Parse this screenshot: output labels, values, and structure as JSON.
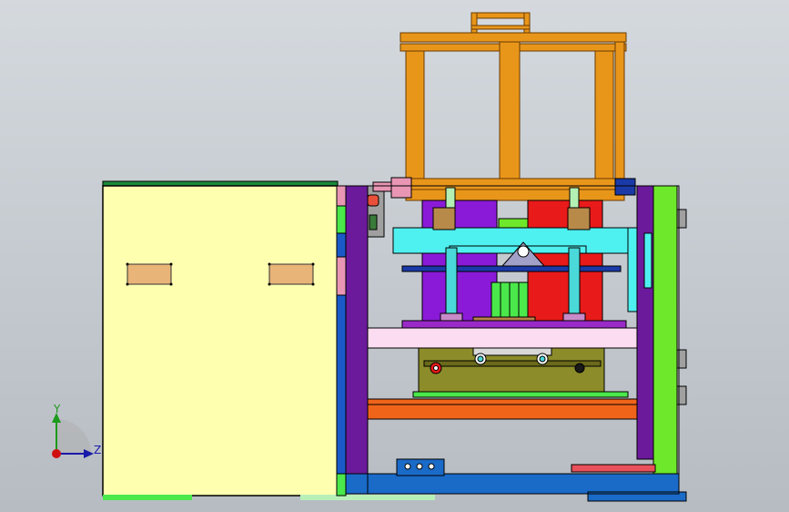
{
  "viewport": {
    "background_top": "#d4d9de",
    "background_bottom": "#b6bcc2"
  },
  "triad": {
    "y_label": "Y",
    "z_label": "Z",
    "y_color": "#1c9a1c",
    "z_color": "#1a1aa8",
    "origin_color": "#d01010"
  },
  "palette": {
    "panel_yellow": "#ffffb0",
    "frame_orange": "#e8961a",
    "pink": "#e896b4",
    "cyan": "#4ff0f0",
    "purple": "#8a1ad8",
    "red": "#e81a1a",
    "blue": "#1a5ac8",
    "green": "#6ee82a",
    "olive": "#8c8c2a",
    "bar_orange": "#f0641a",
    "light_pink": "#fcdcf0"
  }
}
